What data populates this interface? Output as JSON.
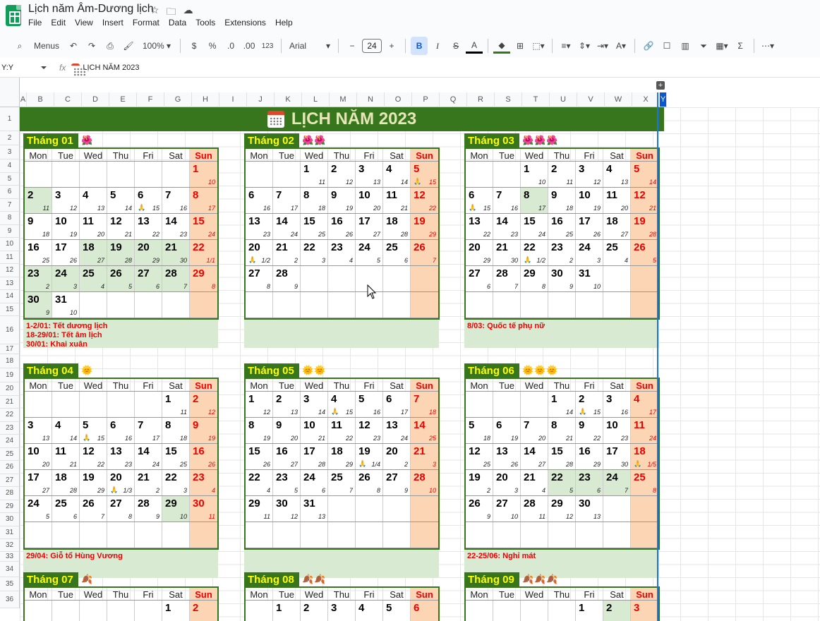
{
  "doc_title": "Lịch năm Âm-Dương lịch",
  "menus": [
    "File",
    "Edit",
    "View",
    "Insert",
    "Format",
    "Data",
    "Tools",
    "Extensions",
    "Help"
  ],
  "toolbar": {
    "menus_label": "Menus",
    "zoom": "100%",
    "currency": "$",
    "percent": "%",
    "dec_less": ".0",
    "dec_more": ".00",
    "number_fmt": "123",
    "font": "Arial",
    "font_size": "24"
  },
  "namebox": "Y:Y",
  "formula_value": "LỊCH NĂM 2023",
  "columns": [
    "A",
    "B",
    "C",
    "D",
    "E",
    "F",
    "G",
    "H",
    "I",
    "J",
    "K",
    "L",
    "M",
    "N",
    "O",
    "P",
    "Q",
    "R",
    "S",
    "T",
    "U",
    "V",
    "W",
    "X",
    "Y"
  ],
  "rows": [
    "1",
    "2",
    "3",
    "4",
    "5",
    "6",
    "7",
    "8",
    "9",
    "10",
    "11",
    "12",
    "13",
    "14",
    "15",
    "16",
    "17",
    "18",
    "19",
    "20",
    "21",
    "22",
    "23",
    "24",
    "25",
    "26",
    "27",
    "28",
    "29",
    "30",
    "31",
    "32",
    "33",
    "34",
    "35",
    "36"
  ],
  "banner_title": "LỊCH NĂM 2023",
  "weekdays": [
    "Mon",
    "Tue",
    "Wed",
    "Thu",
    "Fri",
    "Sat",
    "Sun"
  ],
  "months": [
    {
      "name": "Tháng 01",
      "icon": "🌺",
      "weeks": [
        [
          null,
          null,
          null,
          null,
          null,
          null,
          {
            "d": "1",
            "l": "10"
          }
        ],
        [
          {
            "d": "2",
            "l": "11",
            "h": 1
          },
          {
            "d": "3",
            "l": "12"
          },
          {
            "d": "4",
            "l": "13"
          },
          {
            "d": "5",
            "l": "14"
          },
          {
            "d": "6",
            "l": "15",
            "m": "🙏"
          },
          {
            "d": "7",
            "l": "16"
          },
          {
            "d": "8",
            "l": "17"
          }
        ],
        [
          {
            "d": "9",
            "l": "18"
          },
          {
            "d": "10",
            "l": "19"
          },
          {
            "d": "11",
            "l": "20"
          },
          {
            "d": "12",
            "l": "21"
          },
          {
            "d": "13",
            "l": "22"
          },
          {
            "d": "14",
            "l": "23"
          },
          {
            "d": "15",
            "l": "24"
          }
        ],
        [
          {
            "d": "16",
            "l": "25"
          },
          {
            "d": "17",
            "l": "26"
          },
          {
            "d": "18",
            "l": "27",
            "h": 1
          },
          {
            "d": "19",
            "l": "28",
            "h": 1
          },
          {
            "d": "20",
            "l": "29",
            "h": 1
          },
          {
            "d": "21",
            "l": "30",
            "h": 1
          },
          {
            "d": "22",
            "l": "1/1"
          }
        ],
        [
          {
            "d": "23",
            "l": "2",
            "h": 1
          },
          {
            "d": "24",
            "l": "3",
            "h": 1
          },
          {
            "d": "25",
            "l": "4",
            "h": 1
          },
          {
            "d": "26",
            "l": "5",
            "h": 1
          },
          {
            "d": "27",
            "l": "6",
            "h": 1
          },
          {
            "d": "28",
            "l": "7",
            "h": 1
          },
          {
            "d": "29",
            "l": "8"
          }
        ],
        [
          {
            "d": "30",
            "l": "9",
            "h": 1
          },
          {
            "d": "31",
            "l": "10"
          },
          null,
          null,
          null,
          null,
          null
        ]
      ],
      "notes": [
        "1-2/01: Tết dương lịch",
        "18-29/01: Tết âm lịch",
        "30/01: Khai xuân"
      ]
    },
    {
      "name": "Tháng 02",
      "icon": "🌺🌺",
      "weeks": [
        [
          null,
          null,
          {
            "d": "1",
            "l": "11"
          },
          {
            "d": "2",
            "l": "12"
          },
          {
            "d": "3",
            "l": "13"
          },
          {
            "d": "4",
            "l": "14"
          },
          {
            "d": "5",
            "l": "15",
            "m": "🙏"
          }
        ],
        [
          {
            "d": "6",
            "l": "16"
          },
          {
            "d": "7",
            "l": "17"
          },
          {
            "d": "8",
            "l": "18"
          },
          {
            "d": "9",
            "l": "19"
          },
          {
            "d": "10",
            "l": "20"
          },
          {
            "d": "11",
            "l": "21"
          },
          {
            "d": "12",
            "l": "22"
          }
        ],
        [
          {
            "d": "13",
            "l": "23"
          },
          {
            "d": "14",
            "l": "24"
          },
          {
            "d": "15",
            "l": "25"
          },
          {
            "d": "16",
            "l": "26"
          },
          {
            "d": "17",
            "l": "27"
          },
          {
            "d": "18",
            "l": "28"
          },
          {
            "d": "19",
            "l": "29"
          }
        ],
        [
          {
            "d": "20",
            "l": "1/2",
            "m": "🙏"
          },
          {
            "d": "21",
            "l": "2"
          },
          {
            "d": "22",
            "l": "3"
          },
          {
            "d": "23",
            "l": "4"
          },
          {
            "d": "24",
            "l": "5"
          },
          {
            "d": "25",
            "l": "6"
          },
          {
            "d": "26",
            "l": "7"
          }
        ],
        [
          {
            "d": "27",
            "l": "8"
          },
          {
            "d": "28",
            "l": "9"
          },
          null,
          null,
          null,
          null,
          null
        ],
        [
          null,
          null,
          null,
          null,
          null,
          null,
          null
        ]
      ],
      "notes": []
    },
    {
      "name": "Tháng 03",
      "icon": "🌺🌺🌺",
      "weeks": [
        [
          null,
          null,
          {
            "d": "1",
            "l": "10"
          },
          {
            "d": "2",
            "l": "11"
          },
          {
            "d": "3",
            "l": "12"
          },
          {
            "d": "4",
            "l": "13"
          },
          {
            "d": "5",
            "l": "14"
          }
        ],
        [
          {
            "d": "6",
            "l": "15",
            "m": "🙏"
          },
          {
            "d": "7",
            "l": "16"
          },
          {
            "d": "8",
            "l": "17",
            "h": 1
          },
          {
            "d": "9",
            "l": "18"
          },
          {
            "d": "10",
            "l": "19"
          },
          {
            "d": "11",
            "l": "20"
          },
          {
            "d": "12",
            "l": "21"
          }
        ],
        [
          {
            "d": "13",
            "l": "22"
          },
          {
            "d": "14",
            "l": "23"
          },
          {
            "d": "15",
            "l": "24"
          },
          {
            "d": "16",
            "l": "25"
          },
          {
            "d": "17",
            "l": "26"
          },
          {
            "d": "18",
            "l": "27"
          },
          {
            "d": "19",
            "l": "28"
          }
        ],
        [
          {
            "d": "20",
            "l": "29"
          },
          {
            "d": "21",
            "l": "30"
          },
          {
            "d": "22",
            "l": "1/2",
            "m": "🙏"
          },
          {
            "d": "23",
            "l": "2"
          },
          {
            "d": "24",
            "l": "3"
          },
          {
            "d": "25",
            "l": "4"
          },
          {
            "d": "26",
            "l": "5"
          }
        ],
        [
          {
            "d": "27",
            "l": "6"
          },
          {
            "d": "28",
            "l": "7"
          },
          {
            "d": "29",
            "l": "8"
          },
          {
            "d": "30",
            "l": "9"
          },
          {
            "d": "31",
            "l": "10"
          },
          null,
          null
        ],
        [
          null,
          null,
          null,
          null,
          null,
          null,
          null
        ]
      ],
      "notes": [
        "8/03: Quốc tế phụ nữ"
      ]
    },
    {
      "name": "Tháng 04",
      "icon": "🌞",
      "weeks": [
        [
          null,
          null,
          null,
          null,
          null,
          {
            "d": "1",
            "l": "11"
          },
          {
            "d": "2",
            "l": "12"
          }
        ],
        [
          {
            "d": "3",
            "l": "13"
          },
          {
            "d": "4",
            "l": "14"
          },
          {
            "d": "5",
            "l": "15",
            "m": "🙏"
          },
          {
            "d": "6",
            "l": "16"
          },
          {
            "d": "7",
            "l": "17"
          },
          {
            "d": "8",
            "l": "18"
          },
          {
            "d": "9",
            "l": "19"
          }
        ],
        [
          {
            "d": "10",
            "l": "20"
          },
          {
            "d": "11",
            "l": "21"
          },
          {
            "d": "12",
            "l": "22"
          },
          {
            "d": "13",
            "l": "23"
          },
          {
            "d": "14",
            "l": "24"
          },
          {
            "d": "15",
            "l": "25"
          },
          {
            "d": "16",
            "l": "26"
          }
        ],
        [
          {
            "d": "17",
            "l": "27"
          },
          {
            "d": "18",
            "l": "28"
          },
          {
            "d": "19",
            "l": "29"
          },
          {
            "d": "20",
            "l": "1/3",
            "m": "🙏"
          },
          {
            "d": "21",
            "l": "2"
          },
          {
            "d": "22",
            "l": "3"
          },
          {
            "d": "23",
            "l": "4"
          }
        ],
        [
          {
            "d": "24",
            "l": "5"
          },
          {
            "d": "25",
            "l": "6"
          },
          {
            "d": "26",
            "l": "7"
          },
          {
            "d": "27",
            "l": "8"
          },
          {
            "d": "28",
            "l": "9"
          },
          {
            "d": "29",
            "l": "10",
            "h": 1
          },
          {
            "d": "30",
            "l": "11"
          }
        ],
        [
          null,
          null,
          null,
          null,
          null,
          null,
          null
        ]
      ],
      "notes": [
        "29/04: Giỗ tổ Hùng Vương"
      ]
    },
    {
      "name": "Tháng 05",
      "icon": "🌞🌞",
      "weeks": [
        [
          {
            "d": "1",
            "l": "12"
          },
          {
            "d": "2",
            "l": "13"
          },
          {
            "d": "3",
            "l": "14"
          },
          {
            "d": "4",
            "l": "15",
            "m": "🙏"
          },
          {
            "d": "5",
            "l": "16"
          },
          {
            "d": "6",
            "l": "17"
          },
          {
            "d": "7",
            "l": "18"
          }
        ],
        [
          {
            "d": "8",
            "l": "19"
          },
          {
            "d": "9",
            "l": "20"
          },
          {
            "d": "10",
            "l": "21"
          },
          {
            "d": "11",
            "l": "22"
          },
          {
            "d": "12",
            "l": "23"
          },
          {
            "d": "13",
            "l": "24"
          },
          {
            "d": "14",
            "l": "25"
          }
        ],
        [
          {
            "d": "15",
            "l": "26"
          },
          {
            "d": "16",
            "l": "27"
          },
          {
            "d": "17",
            "l": "28"
          },
          {
            "d": "18",
            "l": "29"
          },
          {
            "d": "19",
            "l": "1/4",
            "m": "🙏"
          },
          {
            "d": "20",
            "l": "2"
          },
          {
            "d": "21",
            "l": "3"
          }
        ],
        [
          {
            "d": "22",
            "l": "4"
          },
          {
            "d": "23",
            "l": "5"
          },
          {
            "d": "24",
            "l": "6"
          },
          {
            "d": "25",
            "l": "7"
          },
          {
            "d": "26",
            "l": "8"
          },
          {
            "d": "27",
            "l": "9"
          },
          {
            "d": "28",
            "l": "10"
          }
        ],
        [
          {
            "d": "29",
            "l": "11"
          },
          {
            "d": "30",
            "l": "12"
          },
          {
            "d": "31",
            "l": "13"
          },
          null,
          null,
          null,
          null
        ],
        [
          null,
          null,
          null,
          null,
          null,
          null,
          null
        ]
      ],
      "notes": []
    },
    {
      "name": "Tháng 06",
      "icon": "🌞🌞🌞",
      "weeks": [
        [
          null,
          null,
          null,
          {
            "d": "1",
            "l": "14"
          },
          {
            "d": "2",
            "l": "15",
            "m": "🙏"
          },
          {
            "d": "3",
            "l": "16"
          },
          {
            "d": "4",
            "l": "17"
          }
        ],
        [
          {
            "d": "5",
            "l": "18"
          },
          {
            "d": "6",
            "l": "19"
          },
          {
            "d": "7",
            "l": "20"
          },
          {
            "d": "8",
            "l": "21"
          },
          {
            "d": "9",
            "l": "22"
          },
          {
            "d": "10",
            "l": "23"
          },
          {
            "d": "11",
            "l": "24"
          }
        ],
        [
          {
            "d": "12",
            "l": "25"
          },
          {
            "d": "13",
            "l": "26"
          },
          {
            "d": "14",
            "l": "27"
          },
          {
            "d": "15",
            "l": "28"
          },
          {
            "d": "16",
            "l": "29"
          },
          {
            "d": "17",
            "l": "30"
          },
          {
            "d": "18",
            "l": "1/5",
            "m": "🙏"
          }
        ],
        [
          {
            "d": "19",
            "l": "2"
          },
          {
            "d": "20",
            "l": "3"
          },
          {
            "d": "21",
            "l": "4"
          },
          {
            "d": "22",
            "l": "5",
            "h": 1
          },
          {
            "d": "23",
            "l": "6",
            "h": 1
          },
          {
            "d": "24",
            "l": "7",
            "h": 1
          },
          {
            "d": "25",
            "l": "8"
          }
        ],
        [
          {
            "d": "26",
            "l": "9"
          },
          {
            "d": "27",
            "l": "10"
          },
          {
            "d": "28",
            "l": "11"
          },
          {
            "d": "29",
            "l": "12"
          },
          {
            "d": "30",
            "l": "13"
          },
          null,
          null
        ],
        [
          null,
          null,
          null,
          null,
          null,
          null,
          null
        ]
      ],
      "notes": [
        "22-25/06: Nghỉ mát"
      ]
    },
    {
      "name": "Tháng 07",
      "icon": "🍂",
      "weeks": [
        [
          null,
          null,
          null,
          null,
          null,
          {
            "d": "1",
            "l": ""
          },
          {
            "d": "2",
            "l": ""
          }
        ]
      ],
      "notes": []
    },
    {
      "name": "Tháng 08",
      "icon": "🍂🍂",
      "weeks": [
        [
          null,
          {
            "d": "1",
            "l": ""
          },
          {
            "d": "2",
            "l": ""
          },
          {
            "d": "3",
            "l": ""
          },
          {
            "d": "4",
            "l": ""
          },
          {
            "d": "5",
            "l": ""
          },
          {
            "d": "6",
            "l": ""
          }
        ]
      ],
      "notes": []
    },
    {
      "name": "Tháng 09",
      "icon": "🍂🍂🍂",
      "weeks": [
        [
          null,
          null,
          null,
          null,
          {
            "d": "1",
            "l": ""
          },
          {
            "d": "2",
            "l": "",
            "h": 1
          },
          {
            "d": "3",
            "l": ""
          }
        ]
      ],
      "notes": []
    }
  ]
}
